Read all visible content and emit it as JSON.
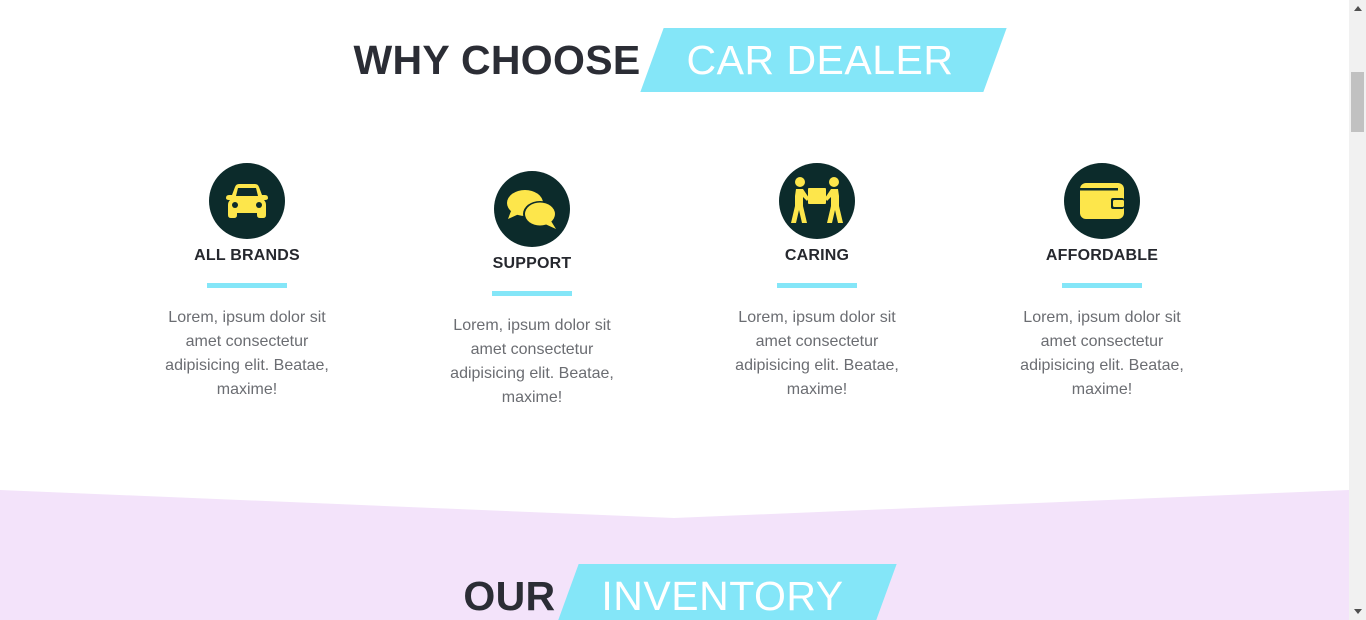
{
  "why_section": {
    "title_dark": "WHY CHOOSE",
    "title_light": "CAR DEALER"
  },
  "features": [
    {
      "icon": "car-icon",
      "title": "ALL BRANDS",
      "text": "Lorem, ipsum dolor sit amet consectetur adipisicing elit. Beatae, maxime!"
    },
    {
      "icon": "chat-bubbles-icon",
      "title": "SUPPORT",
      "text": "Lorem, ipsum dolor sit amet consectetur adipisicing elit. Beatae, maxime!"
    },
    {
      "icon": "people-carrying-box-icon",
      "title": "CARING",
      "text": "Lorem, ipsum dolor sit amet consectetur adipisicing elit. Beatae, maxime!"
    },
    {
      "icon": "wallet-icon",
      "title": "AFFORDABLE",
      "text": "Lorem, ipsum dolor sit amet consectetur adipisicing elit. Beatae, maxime!"
    }
  ],
  "inventory_section": {
    "title_dark": "OUR",
    "title_light": "INVENTORY"
  },
  "colors": {
    "accent": "#84e6f8",
    "icon_bg": "#0c2b2b",
    "icon_fg": "#fde64b",
    "band": "#f3e3fa",
    "heading": "#2b2d35",
    "body_text": "#6b6d72"
  }
}
